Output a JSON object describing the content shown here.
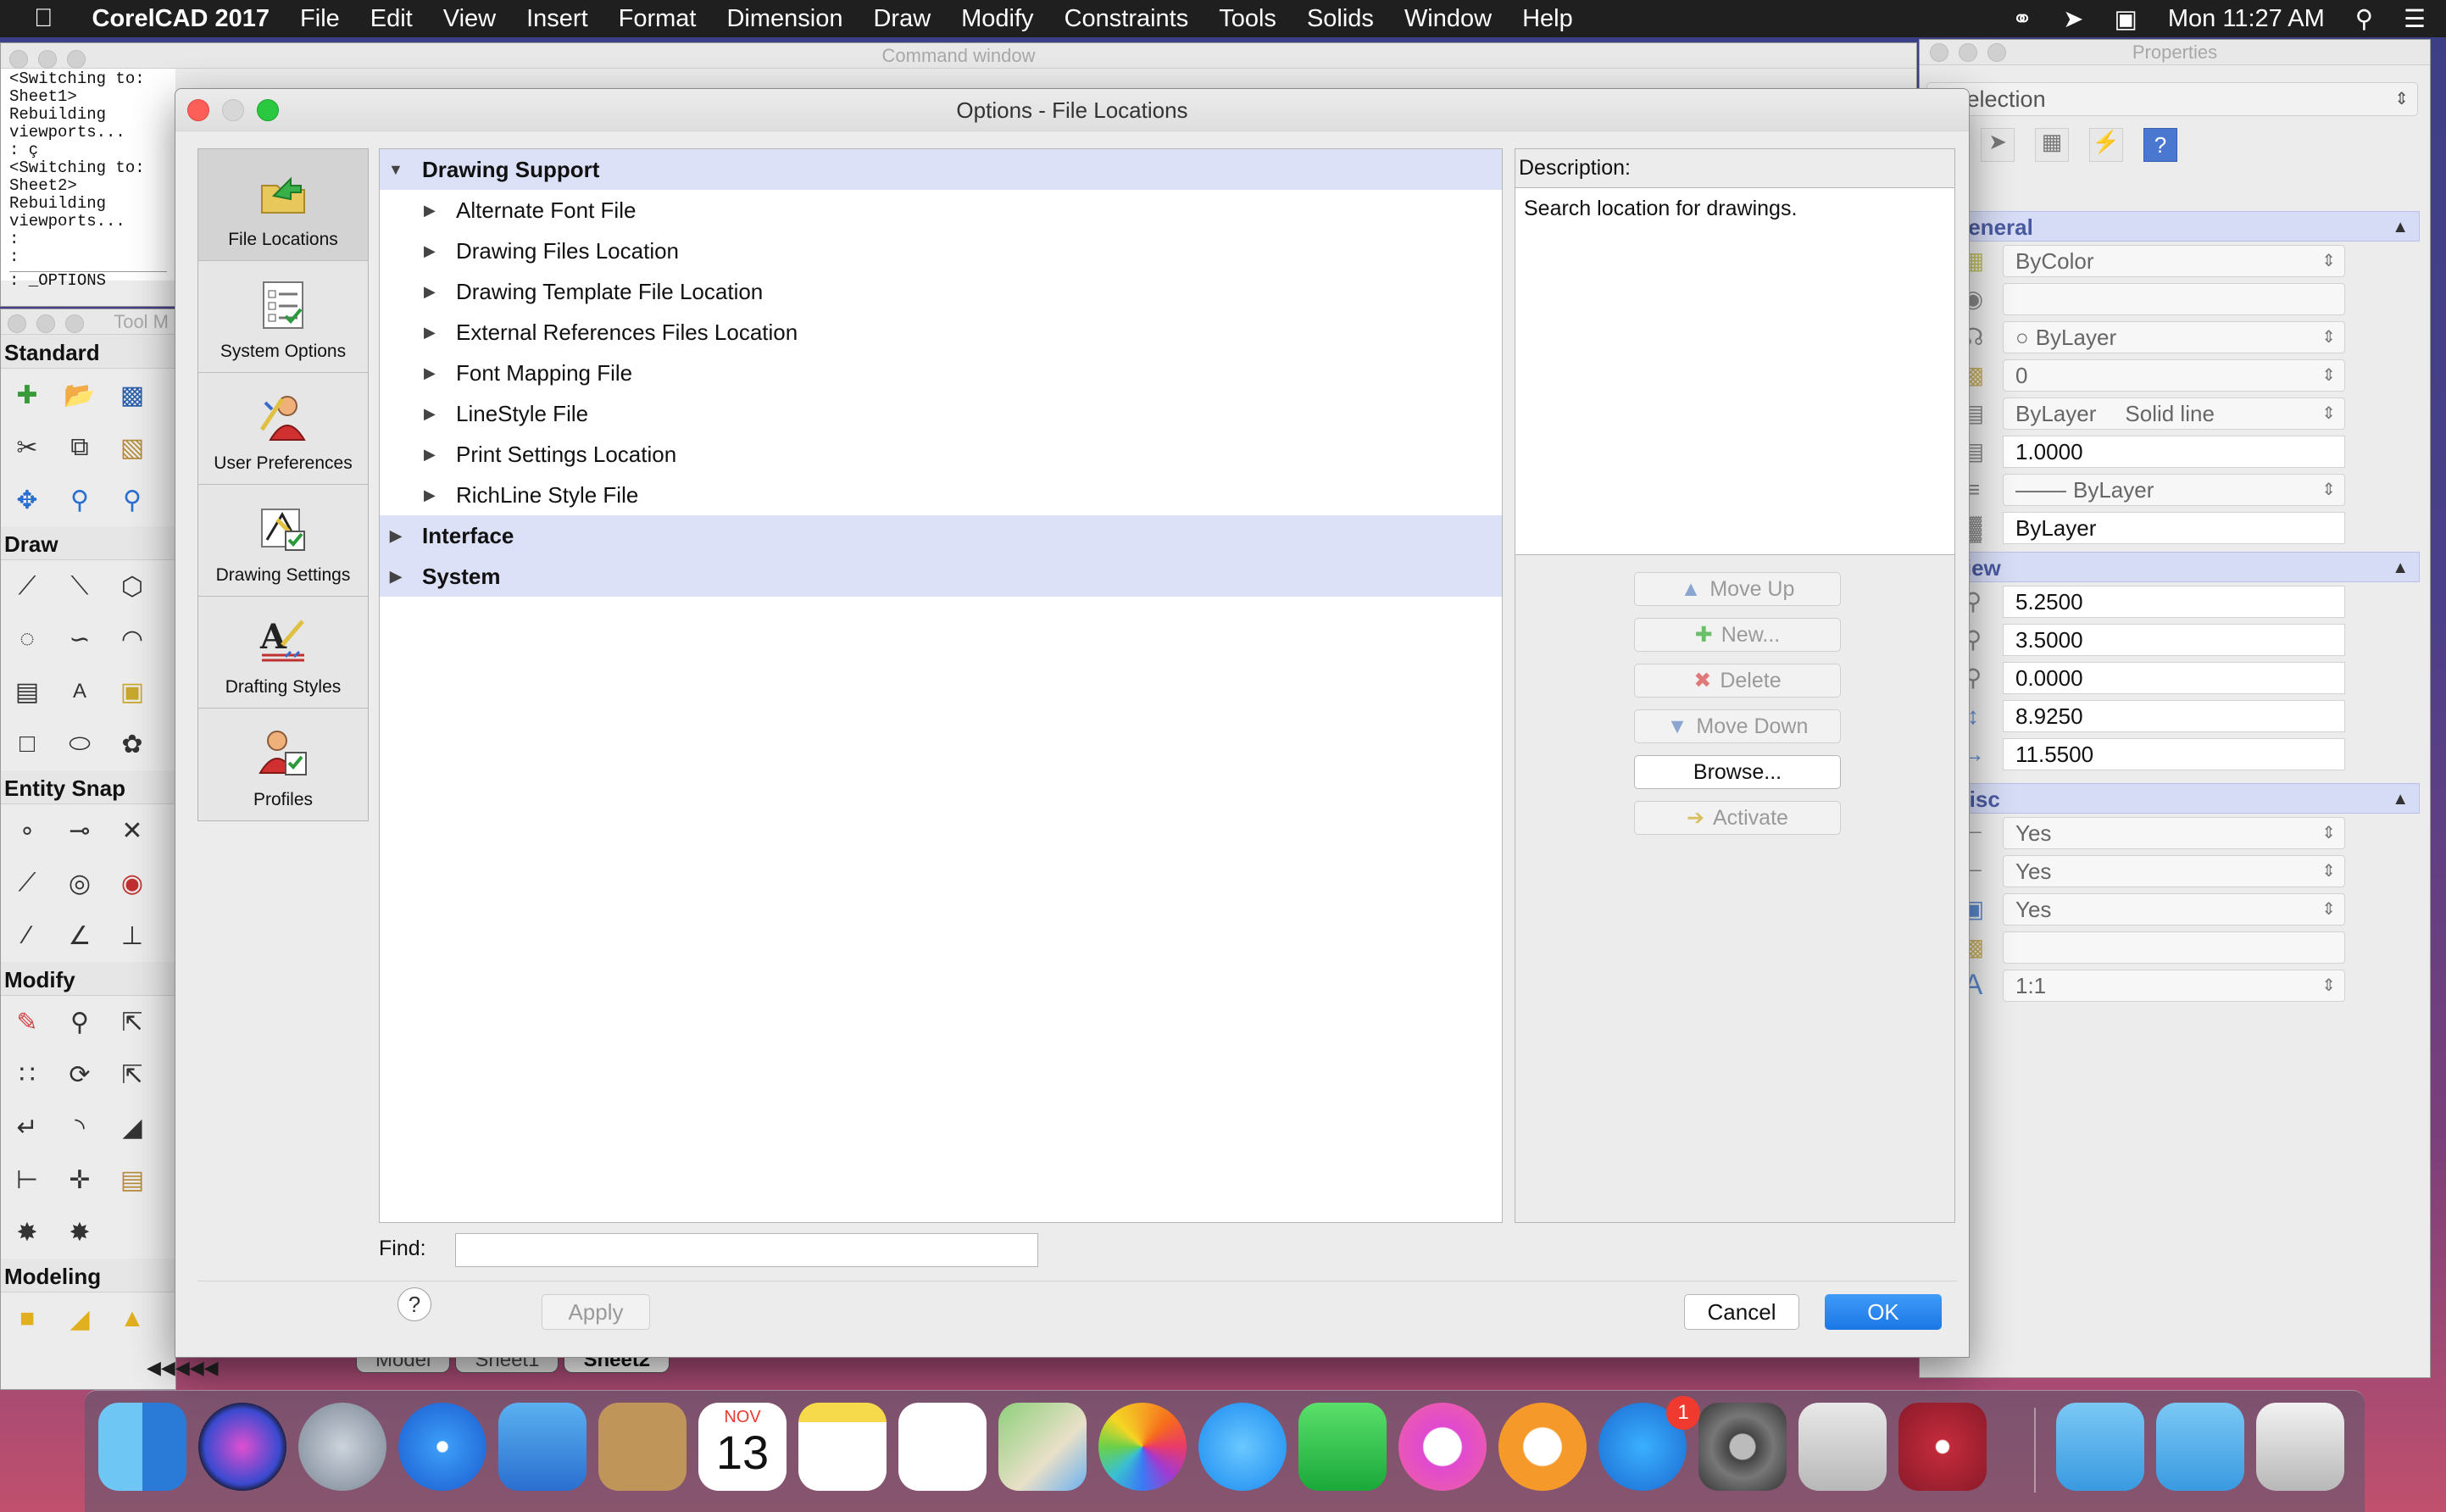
{
  "menubar": {
    "app": "CorelCAD 2017",
    "menus": [
      "File",
      "Edit",
      "View",
      "Insert",
      "Format",
      "Dimension",
      "Draw",
      "Modify",
      "Constraints",
      "Tools",
      "Solids",
      "Window",
      "Help"
    ],
    "clock": "Mon 11:27 AM"
  },
  "command_window": {
    "title": "Command window",
    "lines": [
      "<Switching to: Sheet1>",
      "Rebuilding viewports...",
      ": ç",
      "<Switching to: Sheet2>",
      "Rebuilding viewports...",
      ":",
      ":",
      ": _OPTIONS"
    ]
  },
  "toolbox": {
    "title": "Tool M",
    "sections": [
      "Standard",
      "Draw",
      "Entity Snap",
      "Modify",
      "Modeling"
    ],
    "scroll_arrows": "◀◀◀◀◀"
  },
  "properties": {
    "title": "Properties",
    "selection": "o Selection",
    "groups": {
      "general": "General",
      "view": "View",
      "misc": "Misc"
    },
    "general_values": [
      "ByColor",
      "",
      "ByLayer",
      "0",
      "ByLayer",
      "Solid line",
      "1.0000",
      "ByLayer",
      "ByLayer"
    ],
    "view_values": [
      "5.2500",
      "3.5000",
      "0.0000",
      "8.9250",
      "11.5500"
    ],
    "misc_values": [
      "Yes",
      "Yes",
      "Yes",
      "",
      "1:1"
    ]
  },
  "sheet_tabs": [
    "Model",
    "Sheet1",
    "Sheet2"
  ],
  "dialog": {
    "title": "Options - File Locations",
    "sidebar": [
      {
        "label": "File Locations",
        "selected": true
      },
      {
        "label": "System Options",
        "selected": false
      },
      {
        "label": "User Preferences",
        "selected": false
      },
      {
        "label": "Drawing Settings",
        "selected": false
      },
      {
        "label": "Drafting Styles",
        "selected": false
      },
      {
        "label": "Profiles",
        "selected": false
      }
    ],
    "tree": {
      "drawing_support": "Drawing Support",
      "children": [
        "Alternate Font File",
        "Drawing Files Location",
        "Drawing Template File Location",
        "External References Files Location",
        "Font Mapping File",
        "LineStyle File",
        "Print Settings Location",
        "RichLine Style File"
      ],
      "interface": "Interface",
      "system": "System"
    },
    "description_label": "Description:",
    "description_text": "Search location for drawings.",
    "buttons": {
      "move_up": "Move  Up",
      "new": "New...",
      "delete": "Delete",
      "move_down": "Move Down",
      "browse": "Browse...",
      "activate": "Activate"
    },
    "find_label": "Find:",
    "find_value": "",
    "help": "?",
    "apply": "Apply",
    "cancel": "Cancel",
    "ok": "OK"
  },
  "dock": {
    "calendar_month": "NOV",
    "calendar_day": "13",
    "appstore_badge": "1"
  },
  "colors": {
    "ok_blue": "#1b77e6",
    "tree_category": "#dde1f8",
    "prop_group": "#d6dcf5"
  }
}
